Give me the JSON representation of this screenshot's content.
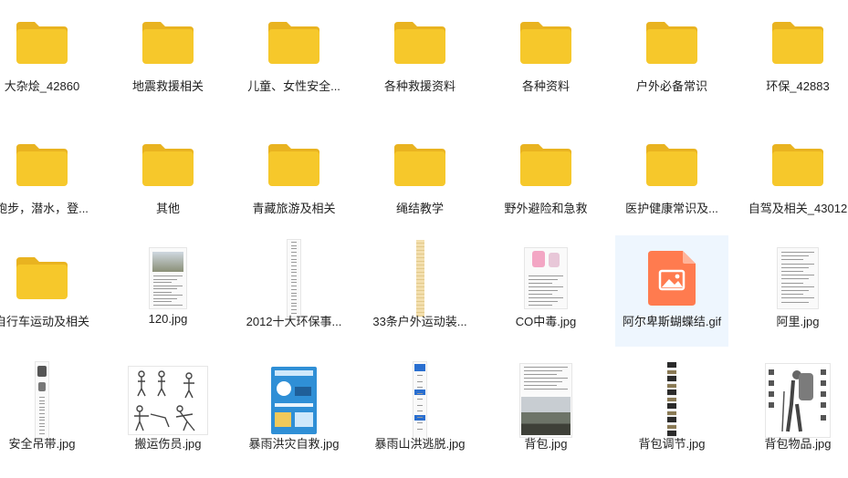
{
  "items": [
    {
      "name": "大杂烩_42860",
      "type": "folder"
    },
    {
      "name": "地震救援相关",
      "type": "folder"
    },
    {
      "name": "儿童、女性安全...",
      "type": "folder"
    },
    {
      "name": "各种救援资料",
      "type": "folder"
    },
    {
      "name": "各种资料",
      "type": "folder"
    },
    {
      "name": "户外必备常识",
      "type": "folder"
    },
    {
      "name": "环保_42883",
      "type": "folder"
    },
    {
      "name": "跑步，潜水，登...",
      "type": "folder"
    },
    {
      "name": "其他",
      "type": "folder"
    },
    {
      "name": "青藏旅游及相关",
      "type": "folder"
    },
    {
      "name": "绳结教学",
      "type": "folder"
    },
    {
      "name": "野外避险和急救",
      "type": "folder"
    },
    {
      "name": "医护健康常识及...",
      "type": "folder"
    },
    {
      "name": "自驾及相关_43012",
      "type": "folder"
    },
    {
      "name": "自行车运动及相关",
      "type": "folder"
    },
    {
      "name": "120.jpg",
      "type": "image",
      "thumb": "doc-photo"
    },
    {
      "name": "2012十大环保事...",
      "type": "image",
      "thumb": "long-text"
    },
    {
      "name": "33条户外运动装...",
      "type": "image",
      "thumb": "long-beige"
    },
    {
      "name": "CO中毒.jpg",
      "type": "image",
      "thumb": "doc-cartoon"
    },
    {
      "name": "阿尔卑斯蝴蝶结.gif",
      "type": "gif",
      "thumb": "gif-icon",
      "selected": true
    },
    {
      "name": "阿里.jpg",
      "type": "image",
      "thumb": "doc-text"
    },
    {
      "name": "安全吊带.jpg",
      "type": "image",
      "thumb": "long-figures"
    },
    {
      "name": "搬运伤员.jpg",
      "type": "image",
      "thumb": "sketch"
    },
    {
      "name": "暴雨洪灾自救.jpg",
      "type": "image",
      "thumb": "poster-blue"
    },
    {
      "name": "暴雨山洪逃脱.jpg",
      "type": "image",
      "thumb": "long-blue"
    },
    {
      "name": "背包.jpg",
      "type": "image",
      "thumb": "doc-landscape"
    },
    {
      "name": "背包调节.jpg",
      "type": "image",
      "thumb": "long-dark"
    },
    {
      "name": "背包物品.jpg",
      "type": "image",
      "thumb": "backpack-items"
    }
  ],
  "colors": {
    "folder": "#f6c82b",
    "folder_tab": "#e9b320",
    "gif": "#ff7b4f",
    "selected_bg": "#eef6fe"
  }
}
